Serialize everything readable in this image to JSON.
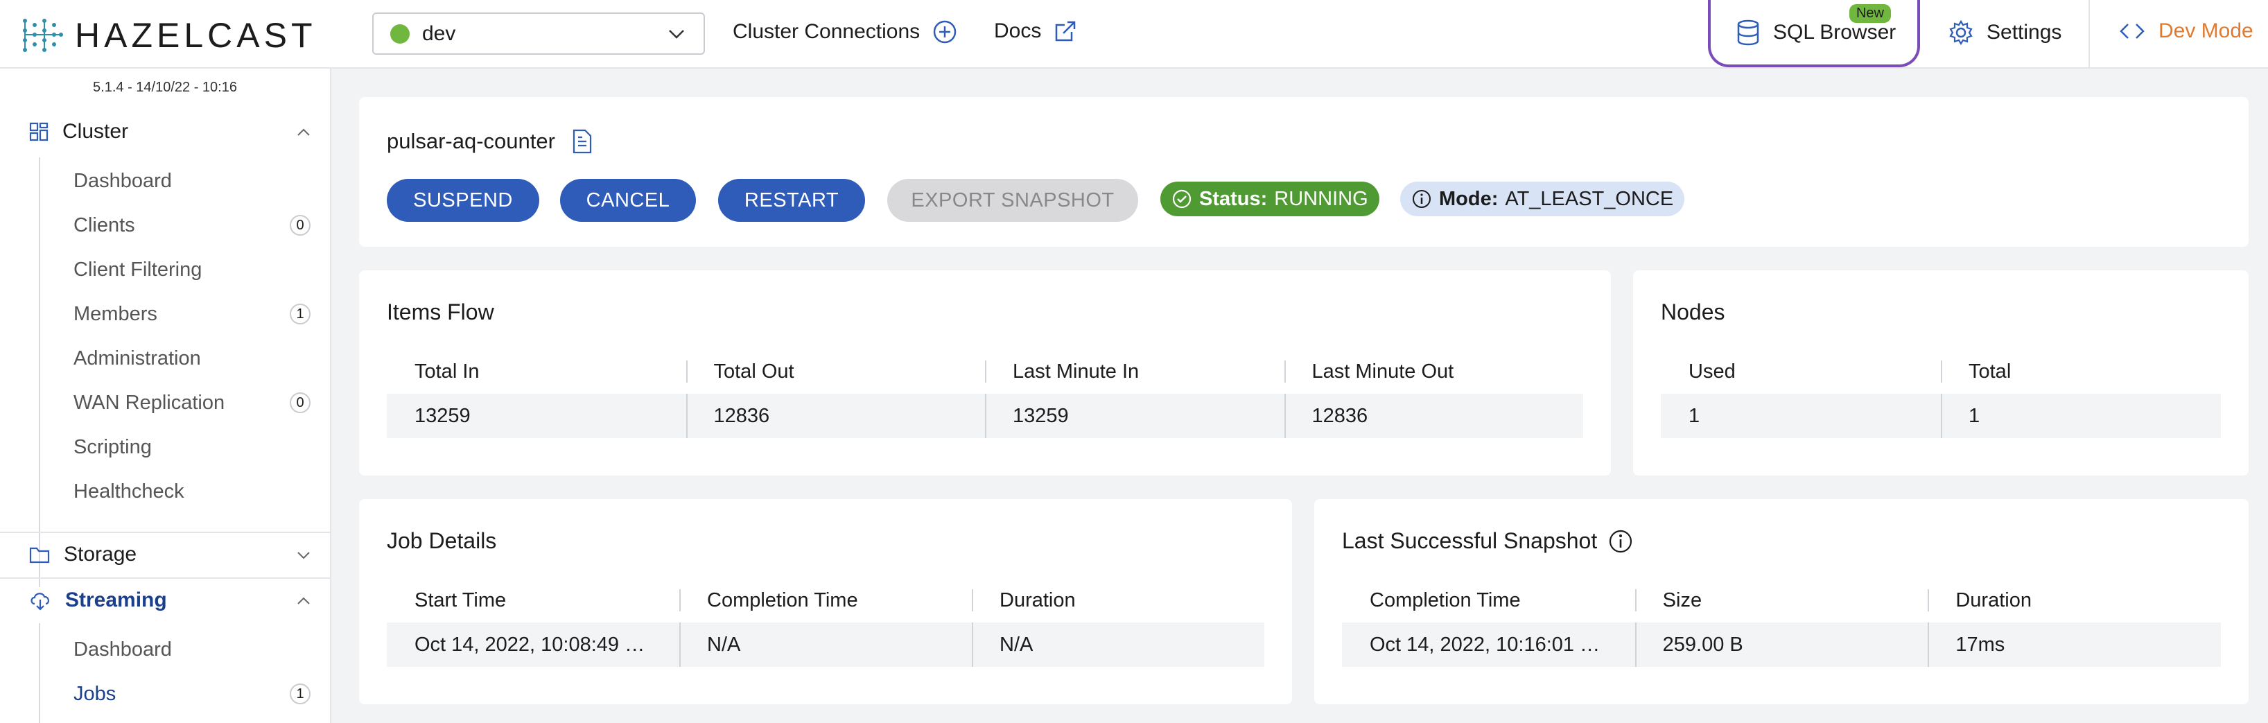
{
  "header": {
    "logo_text": "HAZELCAST",
    "cluster": "dev",
    "cluster_status_color": "#6fb73e",
    "nav_cluster_connections": "Cluster Connections",
    "nav_docs": "Docs",
    "sql_browser": "SQL Browser",
    "new_badge": "New",
    "settings": "Settings",
    "dev_mode": "Dev Mode",
    "dev_mode_color": "#e07a2e"
  },
  "sidebar": {
    "version": "5.1.4 - 14/10/22 - 10:16",
    "cluster_section": "Cluster",
    "cluster_items": [
      {
        "label": "Dashboard"
      },
      {
        "label": "Clients",
        "count": "0"
      },
      {
        "label": "Client Filtering"
      },
      {
        "label": "Members",
        "count": "1"
      },
      {
        "label": "Administration"
      },
      {
        "label": "WAN Replication",
        "count": "0"
      },
      {
        "label": "Scripting"
      },
      {
        "label": "Healthcheck"
      }
    ],
    "storage_section": "Storage",
    "streaming_section": "Streaming",
    "streaming_items": [
      {
        "label": "Dashboard"
      },
      {
        "label": "Jobs",
        "count": "1"
      }
    ]
  },
  "job": {
    "name": "pulsar-aq-counter",
    "buttons": {
      "suspend": "SUSPEND",
      "cancel": "CANCEL",
      "restart": "RESTART",
      "export_snapshot": "EXPORT SNAPSHOT"
    },
    "status_label": "Status:",
    "status_value": "RUNNING",
    "mode_label": "Mode:",
    "mode_value": "AT_LEAST_ONCE"
  },
  "items_flow": {
    "title": "Items Flow",
    "headers": [
      "Total In",
      "Total Out",
      "Last Minute In",
      "Last Minute Out"
    ],
    "values": [
      "13259",
      "12836",
      "13259",
      "12836"
    ]
  },
  "nodes": {
    "title": "Nodes",
    "headers": [
      "Used",
      "Total"
    ],
    "values": [
      "1",
      "1"
    ]
  },
  "job_details": {
    "title": "Job Details",
    "headers": [
      "Start Time",
      "Completion Time",
      "Duration"
    ],
    "values": [
      "Oct 14, 2022, 10:08:49 …",
      "N/A",
      "N/A"
    ]
  },
  "last_snapshot": {
    "title": "Last Successful Snapshot",
    "headers": [
      "Completion Time",
      "Size",
      "Duration"
    ],
    "values": [
      "Oct 14, 2022, 10:16:01 …",
      "259.00 B",
      "17ms"
    ]
  }
}
